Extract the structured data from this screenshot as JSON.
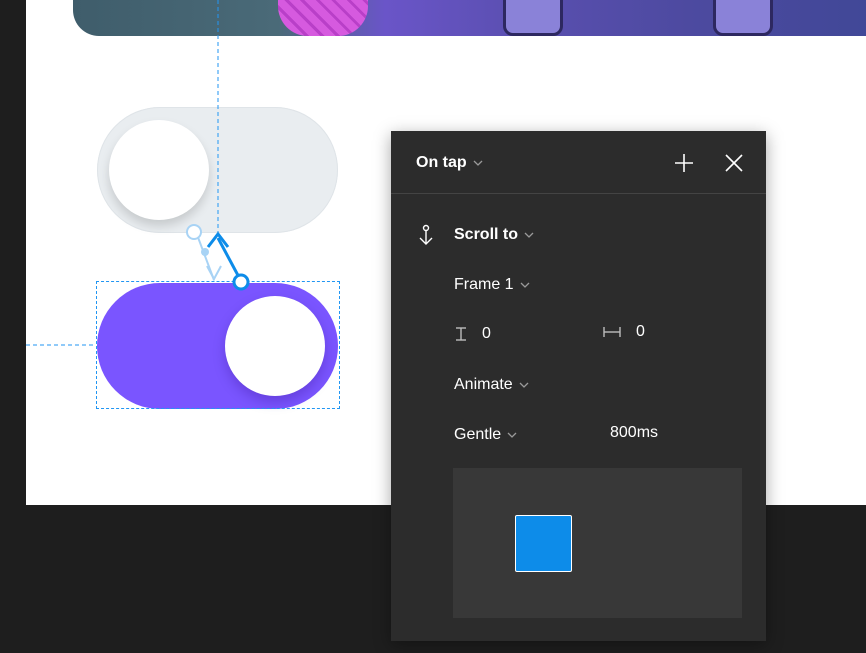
{
  "canvas": {
    "background": "#1e1e1e",
    "frame_color": "#ffffff"
  },
  "toggles": {
    "off_track": "#e9edf0",
    "on_track": "#7a55ff",
    "knob": "#ffffff"
  },
  "prototype": {
    "connection_color": "#2196f3"
  },
  "interaction_panel": {
    "trigger": "On tap",
    "add_icon": "plus-icon",
    "close_icon": "close-icon",
    "action_icon": "anchor-icon",
    "action": "Scroll to",
    "destination": "Frame 1",
    "offset_y_icon": "vertical-offset-icon",
    "offset_y": "0",
    "offset_x_icon": "horizontal-offset-icon",
    "offset_x": "0",
    "animation": "Animate",
    "easing": "Gentle",
    "duration": "800ms",
    "preview_color": "#0d8ce9"
  }
}
